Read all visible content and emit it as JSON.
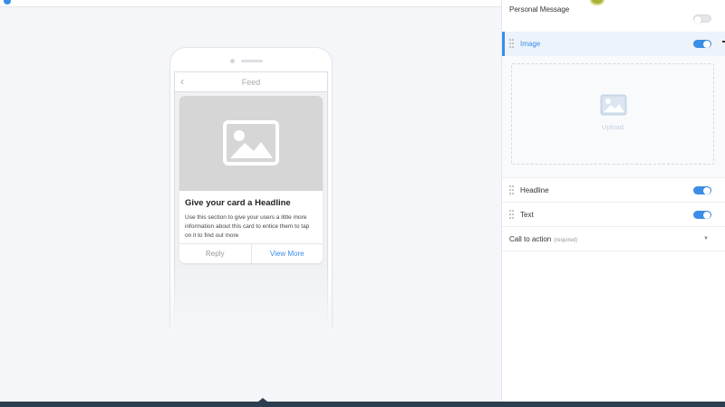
{
  "phone": {
    "nav_back": "‹",
    "nav_title": "Feed",
    "card": {
      "headline": "Give your card a Headline",
      "text": "Use this section to give your users a little more information about this card to entice them to tap on it to find out more",
      "reply_label": "Reply",
      "view_more_label": "View More"
    }
  },
  "panel": {
    "personal_message": {
      "label": "Personal Message",
      "enabled": false
    },
    "image": {
      "label": "Image",
      "enabled": true,
      "upload_label": "Upload"
    },
    "headline": {
      "label": "Headline",
      "enabled": true
    },
    "text": {
      "label": "Text",
      "enabled": true
    },
    "cta": {
      "label": "Call to action",
      "required_label": "(required)",
      "arrow": "▼"
    }
  },
  "colors": {
    "accent": "#3a8ee6",
    "canvas_bg": "#f4f6f9",
    "bottom_bar": "#2d3e50"
  },
  "icons": {
    "card_image": "image-placeholder-icon",
    "upload": "image-upload-icon",
    "drag": "drag-handle-icon",
    "back": "chevron-left-icon",
    "dropdown": "chevron-down-icon"
  }
}
